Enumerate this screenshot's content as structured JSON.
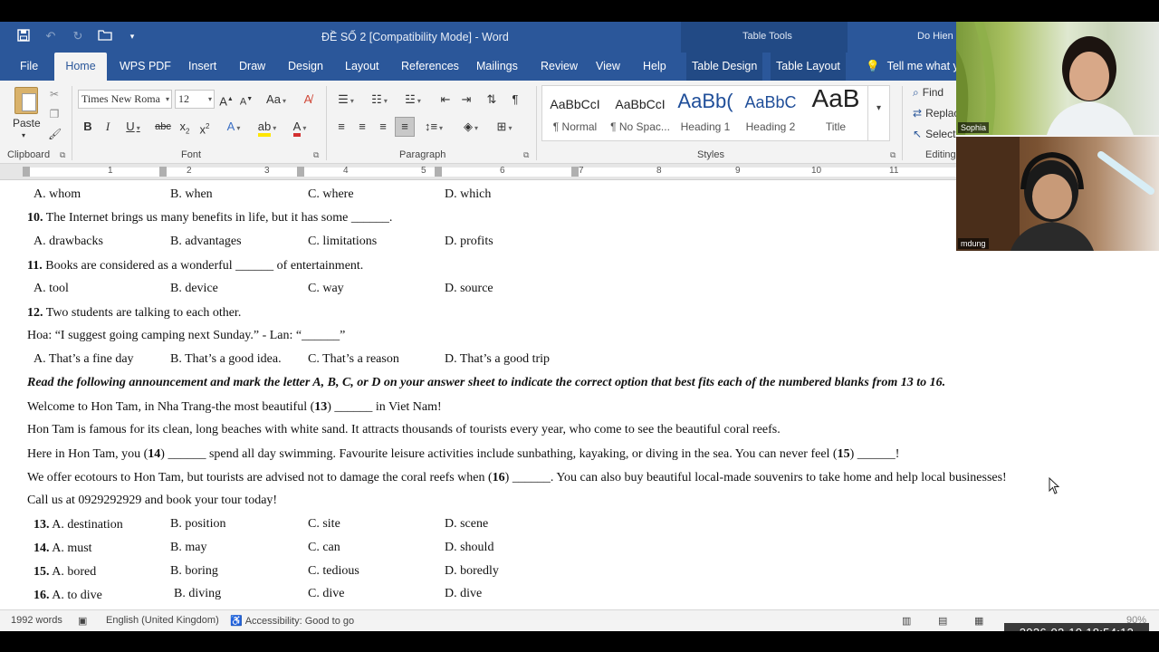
{
  "app": {
    "doc_title": "ĐỀ SỐ 2 [Compatibility Mode]  -  Word",
    "context_tab_group": "Table Tools",
    "user_name": "Do Hien"
  },
  "tabs": [
    "File",
    "Home",
    "WPS PDF",
    "Insert",
    "Draw",
    "Design",
    "Layout",
    "References",
    "Mailings",
    "Review",
    "View",
    "Help",
    "Table Design",
    "Table Layout"
  ],
  "tell_me": "Tell me what yo",
  "ribbon": {
    "clipboard": {
      "paste_label": "Paste",
      "group_label": "Clipboard"
    },
    "font": {
      "font_name": "Times New Roma",
      "font_size": "12",
      "group_label": "Font"
    },
    "paragraph": {
      "group_label": "Paragraph"
    },
    "styles": {
      "group_label": "Styles",
      "items": [
        {
          "sample": "AaBbCcI",
          "name": "¶ Normal"
        },
        {
          "sample": "AaBbCcI",
          "name": "¶ No Spac..."
        },
        {
          "sample": "AaBb(",
          "name": "Heading 1"
        },
        {
          "sample": "AaBbC",
          "name": "Heading 2"
        },
        {
          "sample": "AaB",
          "name": "Title"
        }
      ]
    },
    "editing": {
      "find": "Find",
      "replace": "Replac",
      "select": "Select",
      "group_label": "Editing"
    }
  },
  "ruler_numbers": [
    "1",
    "2",
    "3",
    "4",
    "5",
    "6",
    "7",
    "8",
    "9",
    "10",
    "11"
  ],
  "document": {
    "q9_options": [
      "A. whom",
      "B. when",
      "C. where",
      "D. which"
    ],
    "q10": {
      "num": "10.",
      "text": " The Internet brings us many benefits in life, but it has some ______."
    },
    "q10_options": [
      "A. drawbacks",
      "B. advantages",
      "C. limitations",
      "D. profits"
    ],
    "q11": {
      "num": "11.",
      "text": " Books are considered as a wonderful ______ of entertainment."
    },
    "q11_options": [
      "A. tool",
      "B. device",
      "C. way",
      "D. source"
    ],
    "q12": {
      "num": "12.",
      "text": " Two students are talking to each other."
    },
    "q12_dialog": "Hoa: “I suggest going camping next Sunday.” - Lan: “______”",
    "q12_options": [
      "A. That’s a fine day",
      "B. That’s a good idea.",
      "C. That’s a reason",
      "D. That’s a good trip"
    ],
    "instruction": "Read the following announcement and mark the letter A, B, C, or D on your answer sheet to indicate the correct option that best fits each of the numbered blanks from 13 to 16.",
    "para1": {
      "a": "Welcome to Hon Tam, in Nha Trang-the most beautiful (",
      "n": "13",
      "b": ") ______ in Viet Nam!"
    },
    "para2": "Hon Tam is famous for its clean, long beaches with white sand. It attracts thousands of tourists every year, who come to see the beautiful coral reefs.",
    "para3": {
      "a": "Here in Hon Tam, you (",
      "n1": "14",
      "b": ") ______ spend all day swimming. Favourite leisure activities include sunbathing, kayaking, or diving in the sea. You can never feel (",
      "n2": "15",
      "c": ") ______!"
    },
    "para4": {
      "a": "We offer ecotours to Hon Tam, but tourists are advised not to damage the coral reefs when (",
      "n": "16",
      "b": ") ______. You can also buy beautiful local-made souvenirs to take home and help local businesses!"
    },
    "para5": "Call us at 0929292929 and book your tour today!",
    "q13": {
      "num": "13.",
      "options": [
        " A. destination",
        "B. position",
        "C. site",
        "D. scene"
      ]
    },
    "q14": {
      "num": "14.",
      "options": [
        " A. must",
        "B. may",
        "C. can",
        "D. should"
      ]
    },
    "q15": {
      "num": "15.",
      "options": [
        " A. bored",
        "B. boring",
        "C. tedious",
        "D. boredly"
      ]
    },
    "q16": {
      "num": "16.",
      "options": [
        " A. to dive",
        "B. diving",
        "C. dive",
        "D. dive"
      ]
    }
  },
  "status": {
    "words": "1992 words",
    "language": "English (United Kingdom)",
    "accessibility": "Accessibility: Good to go",
    "zoom": "90%"
  },
  "timestamp": "2026-02-10  18:54:13",
  "video": {
    "tile1_name": "Sophia",
    "tile2_name": "mdung"
  }
}
